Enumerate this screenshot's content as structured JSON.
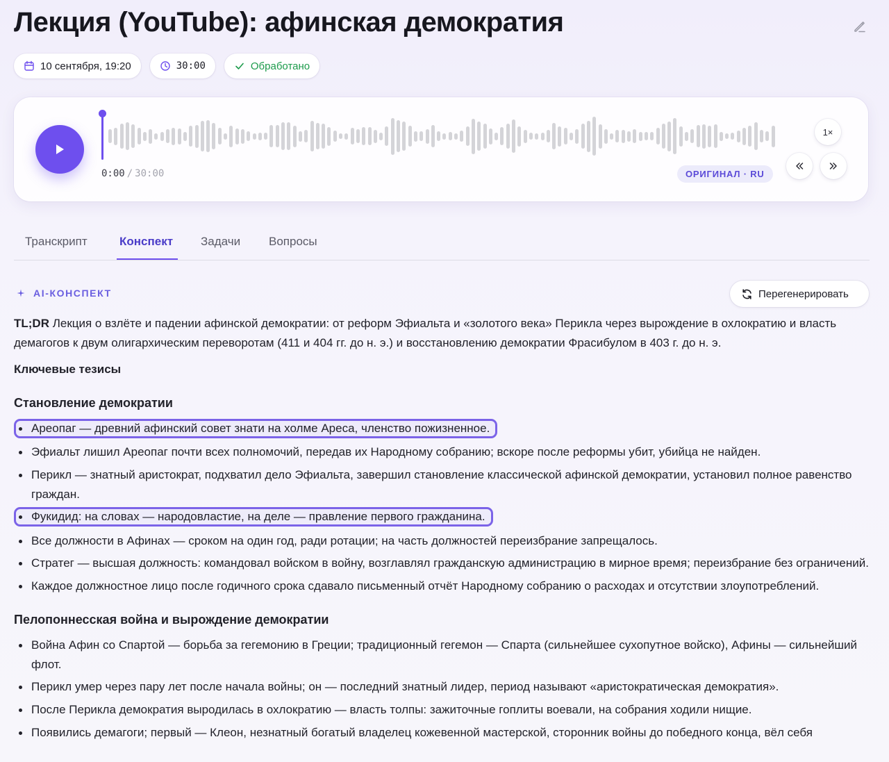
{
  "header": {
    "title": "Лекция (YouTube): афинская демократия",
    "edit_icon": "pencil-icon"
  },
  "chips": {
    "date": "10 сентября, 19:20",
    "duration": "30:00",
    "status": "Обработано",
    "status_color": "#1c9b4b"
  },
  "player": {
    "current_time": "0:00",
    "separator": "/",
    "total_time": "30:00",
    "language_badge": "ОРИГИНАЛ · RU",
    "speed": "1×",
    "progress": 0,
    "accent": "#6e4fee"
  },
  "tabs": [
    {
      "label": "Транскрипт",
      "active": false
    },
    {
      "label": "Конспект",
      "active": true
    },
    {
      "label": "Задачи",
      "active": false
    },
    {
      "label": "Вопросы",
      "active": false
    }
  ],
  "summary": {
    "label": "AI-КОНСПЕКТ",
    "regenerate_label": "Перегенерировать",
    "tldr_prefix": "TL;DR",
    "tldr_text": "Лекция о взлёте и падении афинской демократии: от реформ Эфиальта и «золотого века» Перикла через вырождение в охлократию и власть демагогов к двум олигархическим переворотам (411 и 404 гг. до н. э.) и восстановлению демократии Фрасибулом в 403 г. до н. э.",
    "key_heading": "Ключевые тезисы",
    "section1": {
      "title": "Становление демократии",
      "items": [
        "Ареопаг — древний афинский совет знати на холме Ареса, членство пожизненное.",
        "Эфиальт лишил Ареопаг почти всех полномочий, передав их Народному собранию; вскоре после реформы убит, убийца не найден.",
        "Перикл — знатный аристократ, подхватил дело Эфиальта, завершил становление классической афинской демократии, установил полное равенство граждан.",
        "Фукидид: на словах — народовластие, на деле — правление первого гражданина.",
        "Все должности в Афинах — сроком на один год, ради ротации; на часть должностей переизбрание запрещалось.",
        "Стратег — высшая должность: командовал войском в войну, возглавлял гражданскую администрацию в мирное время; переизбрание без ограничений.",
        "Каждое должностное лицо после годичного срока сдавало письменный отчёт Народному собранию о расходах и отсутствии злоупотреблений."
      ]
    },
    "section2": {
      "title": "Пелопоннесская война и вырождение демократии",
      "items": [
        "Война Афин со Спартой — борьба за гегемонию в Греции; традиционный гегемон — Спарта (сильнейшее сухопутное войско), Афины — сильнейший флот.",
        "Перикл умер через пару лет после начала войны; он — последний знатный лидер, период называют «аристократическая демократия».",
        "После Перикла демократия выродилась в охлократию — власть толпы: зажиточные гоплиты воевали, на собрания ходили нищие.",
        "Появились демагоги; первый — Клеон, незнатный богатый владелец кожевенной мастерской, сторонник войны до победного конца, вёл себя"
      ]
    }
  }
}
